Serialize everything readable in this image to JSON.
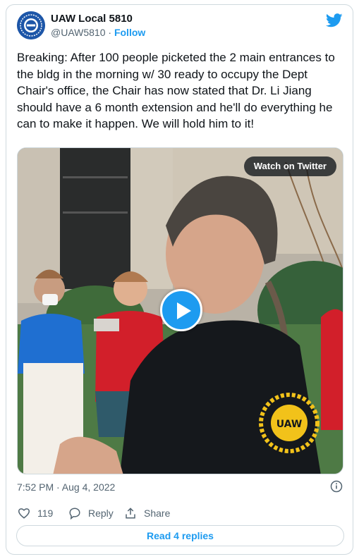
{
  "colors": {
    "accent": "#1d9bf0",
    "text": "#0f1419",
    "muted": "#536471",
    "border": "#cfd9de"
  },
  "header": {
    "avatar_icon": "uaw-logo-icon",
    "name": "UAW Local 5810",
    "handle": "@UAW5810",
    "separator": "·",
    "follow_label": "Follow",
    "brand_icon": "twitter-bird-icon"
  },
  "tweet": {
    "text": "Breaking: After 100 people picketed the 2 main entrances to the bldg in the morning w/ 30 ready to occupy the Dept Chair's office, the Chair has now stated that Dr. Li Jiang should have a 6 month extension and he'll do everything he can to make it happen. We will hold him to it!"
  },
  "media": {
    "watch_label": "Watch on Twitter",
    "play_icon": "play-icon",
    "shirt_logo_text": "UAW"
  },
  "meta": {
    "timestamp": "7:52 PM · Aug 4, 2022",
    "info_icon": "info-icon"
  },
  "actions": {
    "like_count": "119",
    "reply_label": "Reply",
    "share_label": "Share"
  },
  "footer": {
    "read_replies_label": "Read 4 replies"
  }
}
